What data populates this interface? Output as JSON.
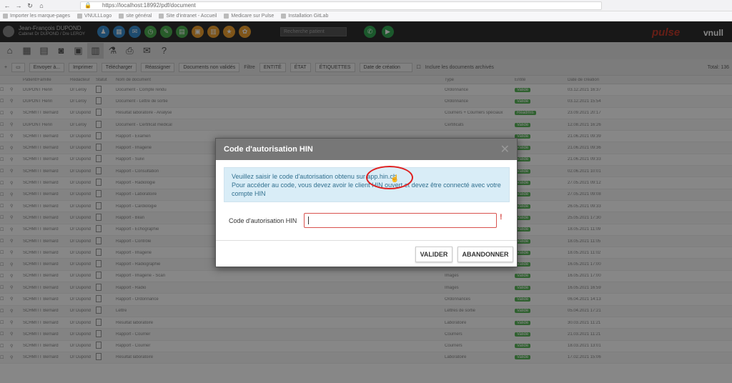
{
  "browser": {
    "url": "https://localhost:18992/pdf/document",
    "bookmarks": [
      "Importer les marque-pages",
      "VNULLLogo",
      "site général",
      "Site d'intranet - Accueil",
      "Medicare sur Pulse",
      "Installation GitLab"
    ]
  },
  "header": {
    "user_name": "Jean-François DUPOND",
    "user_sub": "Cabinet Dr DUPOND / Dre LEROY",
    "search_placeholder": "Recherche patient",
    "logo_pulse": "pulse",
    "logo_vnull": "vnull",
    "icons": [
      {
        "name": "patients-icon",
        "color": "#3a8fd0",
        "glyph": "♟"
      },
      {
        "name": "calendar-icon",
        "color": "#3a8fd0",
        "glyph": "▦"
      },
      {
        "name": "mail-icon",
        "color": "#3a8fd0",
        "glyph": "✉"
      },
      {
        "name": "clock-icon",
        "color": "#4caf50",
        "glyph": "◷"
      },
      {
        "name": "wrench-icon",
        "color": "#4caf50",
        "glyph": "✎"
      },
      {
        "name": "clipboard-icon",
        "color": "#4caf50",
        "glyph": "▤"
      },
      {
        "name": "cart-icon",
        "color": "#f0a030",
        "glyph": "▣"
      },
      {
        "name": "folder-icon",
        "color": "#f0a030",
        "glyph": "▥"
      },
      {
        "name": "star-icon",
        "color": "#f0a030",
        "glyph": "★"
      },
      {
        "name": "certificate-icon",
        "color": "#f0a030",
        "glyph": "✿"
      }
    ]
  },
  "filters": {
    "buttons": [
      "Envoyer à...",
      "Imprimer",
      "Télécharger",
      "Réassigner",
      "Documents non validés",
      "Actions"
    ],
    "dropdowns": [
      "Filtre",
      "ENTITÉ",
      "ÉTAT",
      "ÉTIQUETTES"
    ],
    "search_placeholder": "Date de création",
    "archive_label": "Inclure les documents archivés",
    "total": "Total: 136"
  },
  "table": {
    "headers": [
      "",
      "",
      "Patient/Famille",
      "Rédacteur",
      "Statut",
      "Nom de document",
      "Type",
      "Entité",
      "Date de création"
    ],
    "rows": [
      {
        "patient": "DUPONT Henri",
        "redacteur": "Dr Leroy",
        "doc": "Document - Compte rendu",
        "type": "Ordonnance",
        "status": "Validé",
        "date": "03.12.2021 16:37"
      },
      {
        "patient": "DUPONT Henri",
        "redacteur": "Dr Leroy",
        "doc": "Document - Lettre de sortie",
        "type": "Ordonnance",
        "status": "Validé",
        "date": "03.12.2021 15:54"
      },
      {
        "patient": "SCHMITT Bernard",
        "redacteur": "Dr Dupond",
        "doc": "Résultat laboratoire - Analyse",
        "type": "Courriers + Courriers spéciaux",
        "status": "Réadmis",
        "date": "23.09.2021 20:17"
      },
      {
        "patient": "DUPONT Henri",
        "redacteur": "Dr Leroy",
        "doc": "Document - Certificat médical",
        "type": "Certificats",
        "status": "Validé",
        "date": "12.08.2021 16:26"
      },
      {
        "patient": "SCHMITT Bernard",
        "redacteur": "Dr Dupond",
        "doc": "Rapport - Examen",
        "type": "",
        "status": "Validé",
        "date": "21.06.2021 09:39"
      },
      {
        "patient": "SCHMITT Bernard",
        "redacteur": "Dr Dupond",
        "doc": "Rapport - Imagerie",
        "type": "",
        "status": "Validé",
        "date": "21.06.2021 09:36"
      },
      {
        "patient": "SCHMITT Bernard",
        "redacteur": "Dr Dupond",
        "doc": "Rapport - Suivi",
        "type": "",
        "status": "Validé",
        "date": "21.06.2021 09:33"
      },
      {
        "patient": "SCHMITT Bernard",
        "redacteur": "Dr Dupond",
        "doc": "Rapport - Consultation",
        "type": "",
        "status": "Validé",
        "date": "02.06.2021 10:01"
      },
      {
        "patient": "SCHMITT Bernard",
        "redacteur": "Dr Dupond",
        "doc": "Rapport - Radiologie",
        "type": "",
        "status": "Validé",
        "date": "27.05.2021 09:12"
      },
      {
        "patient": "SCHMITT Bernard",
        "redacteur": "Dr Dupond",
        "doc": "Rapport - Laboratoire",
        "type": "",
        "status": "Validé",
        "date": "27.05.2021 09:08"
      },
      {
        "patient": "SCHMITT Bernard",
        "redacteur": "Dr Dupond",
        "doc": "Rapport - Cardiologie",
        "type": "Courriers",
        "status": "Validé",
        "date": "26.05.2021 09:33"
      },
      {
        "patient": "SCHMITT Bernard",
        "redacteur": "Dr Dupond",
        "doc": "Rapport - Bilan",
        "type": "",
        "status": "Validé",
        "date": "25.05.2021 17:30"
      },
      {
        "patient": "SCHMITT Bernard",
        "redacteur": "Dr Dupond",
        "doc": "Rapport - Échographie",
        "type": "",
        "status": "Validé",
        "date": "18.05.2021 11:09"
      },
      {
        "patient": "SCHMITT Bernard",
        "redacteur": "Dr Dupond",
        "doc": "Rapport - Contrôle",
        "type": "",
        "status": "Validé",
        "date": "18.05.2021 11:05"
      },
      {
        "patient": "SCHMITT Bernard",
        "redacteur": "Dr Dupond",
        "doc": "Rapport - Imagerie",
        "type": "",
        "status": "Validé",
        "date": "18.05.2021 11:02"
      },
      {
        "patient": "SCHMITT Bernard",
        "redacteur": "Dr Dupond",
        "doc": "Rapport - Radiographie",
        "type": "Images",
        "status": "Validé",
        "date": "16.05.2021 17:00"
      },
      {
        "patient": "SCHMITT Bernard",
        "redacteur": "Dr Dupond",
        "doc": "Rapport - Imagerie - Scan",
        "type": "Images",
        "status": "Validé",
        "date": "16.05.2021 17:00"
      },
      {
        "patient": "SCHMITT Bernard",
        "redacteur": "Dr Dupond",
        "doc": "Rapport - Radio",
        "type": "Images",
        "status": "Validé",
        "date": "16.05.2021 16:59"
      },
      {
        "patient": "SCHMITT Bernard",
        "redacteur": "Dr Dupond",
        "doc": "Rapport - Ordonnance",
        "type": "Ordonnances",
        "status": "Validé",
        "date": "06.04.2021 14:13"
      },
      {
        "patient": "SCHMITT Bernard",
        "redacteur": "Dr Dupond",
        "doc": "Lettre",
        "type": "Lettres de sortie",
        "status": "Validé",
        "date": "05.04.2021 17:21"
      },
      {
        "patient": "SCHMITT Bernard",
        "redacteur": "Dr Dupond",
        "doc": "Résultat laboratoire",
        "type": "Laboratoire",
        "status": "Validé",
        "date": "30.03.2021 11:21"
      },
      {
        "patient": "SCHMITT Bernard",
        "redacteur": "Dr Dupond",
        "doc": "Rapport - Courrier",
        "type": "Courriers",
        "status": "Validé",
        "date": "21.03.2021 11:21"
      },
      {
        "patient": "SCHMITT Bernard",
        "redacteur": "Dr Dupond",
        "doc": "Rapport - Courrier",
        "type": "Courriers",
        "status": "Validé",
        "date": "18.03.2021 13:01"
      },
      {
        "patient": "SCHMITT Bernard",
        "redacteur": "Dr Dupond",
        "doc": "Résultat laboratoire",
        "type": "Laboratoire",
        "status": "Validé",
        "date": "17.02.2021 15:06"
      }
    ]
  },
  "modal": {
    "title": "Code d'autorisation HIN",
    "info_prefix": "Veuillez saisir le code d'autorisation obtenu sur ",
    "info_link": "app.hin.ch",
    "info_rest": "Pour accéder au code, vous devez avoir le client HIN ouvert et devez être connecté avec votre compte HIN",
    "field_label": "Code d'autorisation HIN",
    "field_value": "",
    "required_mark": "!",
    "btn_validate": "VALIDER",
    "btn_cancel": "ABANDONNER",
    "close_glyph": "✕"
  }
}
